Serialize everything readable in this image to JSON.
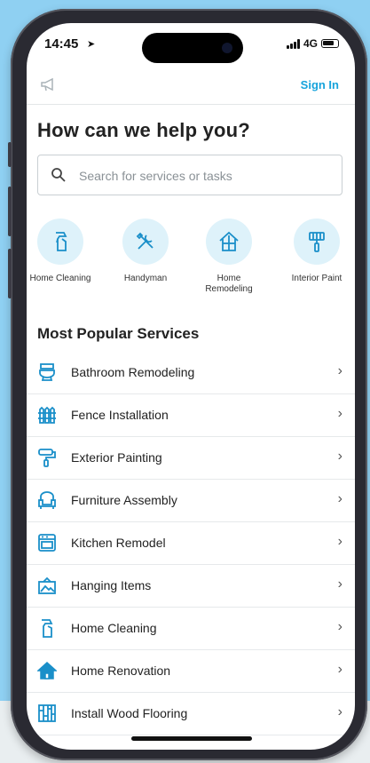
{
  "status_bar": {
    "time": "14:45",
    "network": "4G"
  },
  "top_bar": {
    "sign_in": "Sign In"
  },
  "headline": "How can we help you?",
  "search": {
    "placeholder": "Search for services or tasks"
  },
  "categories": [
    {
      "label": "Home Cleaning",
      "icon": "spray-bottle-icon"
    },
    {
      "label": "Handyman",
      "icon": "tools-icon"
    },
    {
      "label": "Home\nRemodeling",
      "icon": "house-icon"
    },
    {
      "label": "Interior Paint",
      "icon": "paint-brush-icon"
    }
  ],
  "section_title": "Most Popular Services",
  "services": [
    {
      "label": "Bathroom Remodeling",
      "icon": "toilet-icon"
    },
    {
      "label": "Fence Installation",
      "icon": "fence-icon"
    },
    {
      "label": "Exterior Painting",
      "icon": "paint-roller-icon"
    },
    {
      "label": "Furniture Assembly",
      "icon": "armchair-icon"
    },
    {
      "label": "Kitchen Remodel",
      "icon": "oven-icon"
    },
    {
      "label": "Hanging Items",
      "icon": "picture-frame-icon"
    },
    {
      "label": "Home Cleaning",
      "icon": "spray-bottle-icon"
    },
    {
      "label": "Home Renovation",
      "icon": "house-icon"
    },
    {
      "label": "Install Wood Flooring",
      "icon": "wood-floor-icon"
    }
  ],
  "colors": {
    "accent": "#16a3dc",
    "icon_blue": "#1a8fc9",
    "icon_bg": "#def2fa",
    "background": "#8fd0f2"
  }
}
